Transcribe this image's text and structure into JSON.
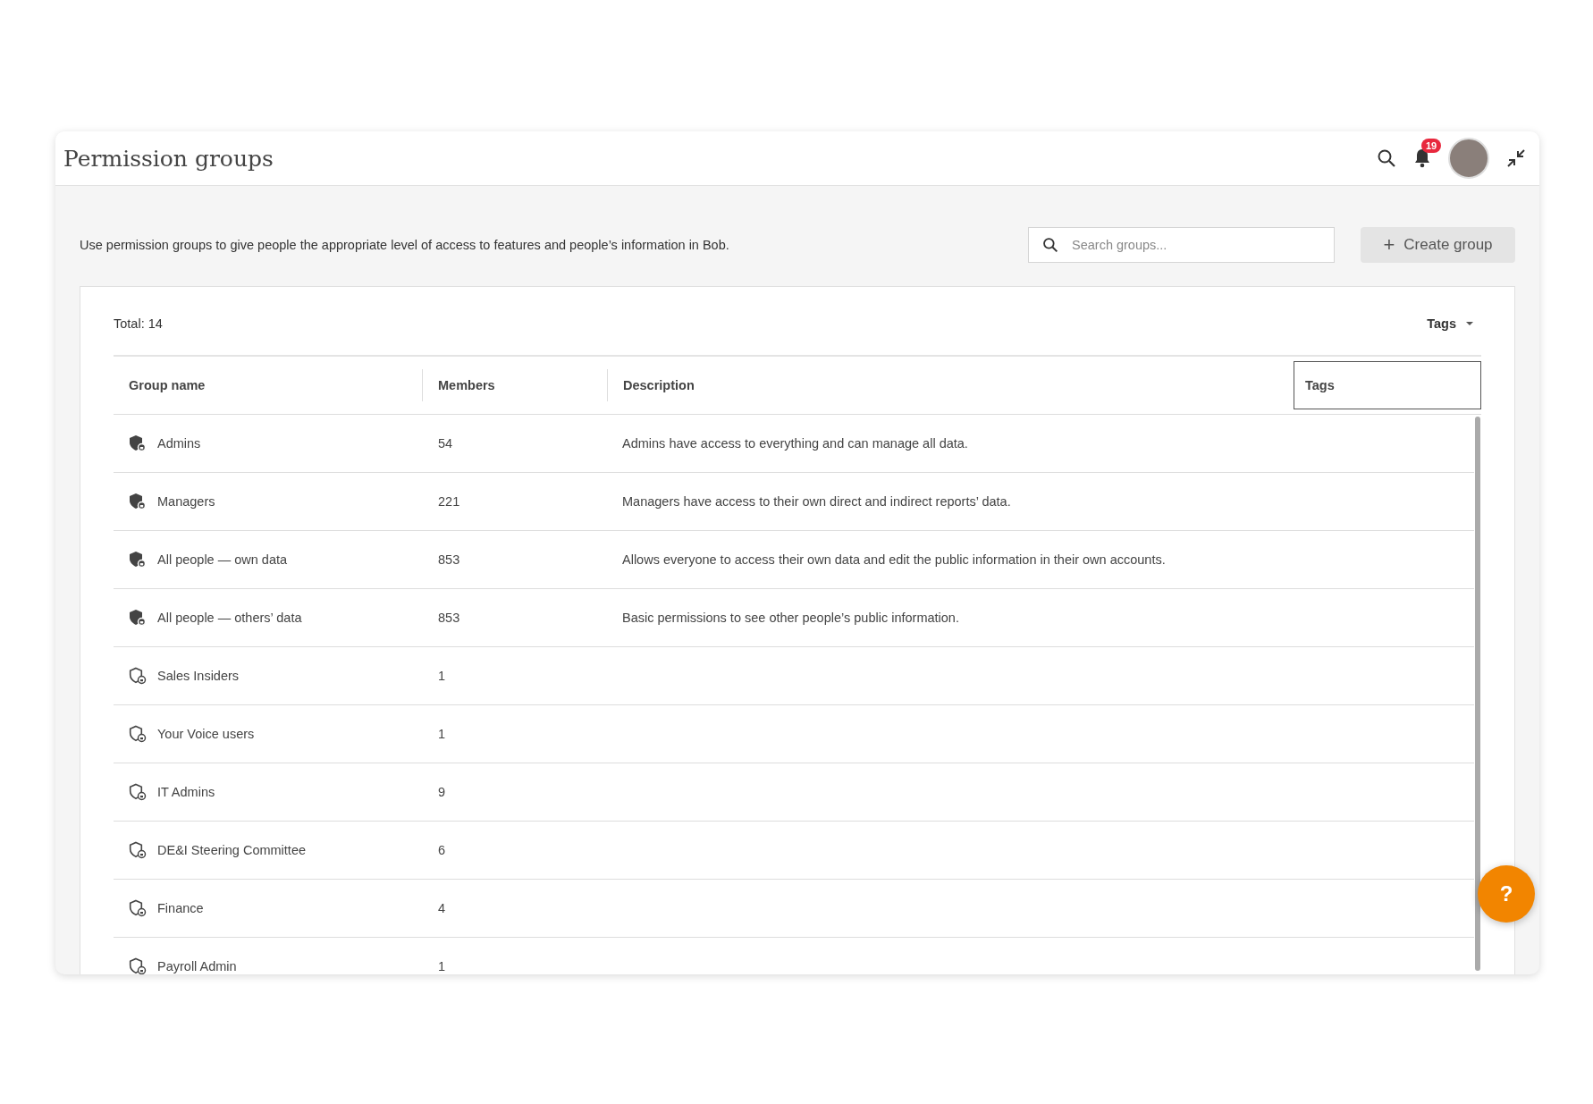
{
  "header": {
    "title": "Permission groups",
    "notification_count": "19"
  },
  "intro": {
    "text": "Use permission groups to give people the appropriate level of access to features and people’s information in Bob.",
    "search": {
      "placeholder": "Search groups..."
    },
    "create_button": {
      "icon": "+",
      "label": "Create group"
    }
  },
  "table": {
    "total": "Total: 14",
    "tags_filter": "Tags",
    "columns": [
      "Group name",
      "Members",
      "Description",
      "Tags"
    ],
    "rows": [
      {
        "kind": "default",
        "name": "Admins",
        "members": "54",
        "description": "Admins have access to everything and can manage all data."
      },
      {
        "kind": "default",
        "name": "Managers",
        "members": "221",
        "description": "Managers have access to their own direct and indirect reports’ data."
      },
      {
        "kind": "default",
        "name": "All people — own data",
        "members": "853",
        "description": "Allows everyone to access their own data and edit the public information in their own accounts."
      },
      {
        "kind": "default",
        "name": "All people — others’ data",
        "members": "853",
        "description": "Basic permissions to see other people’s public information."
      },
      {
        "kind": "custom",
        "name": "Sales Insiders",
        "members": "1"
      },
      {
        "kind": "custom",
        "name": "Your Voice users",
        "members": "1"
      },
      {
        "kind": "custom",
        "name": "IT Admins",
        "members": "9"
      },
      {
        "kind": "custom",
        "name": "DE&I Steering Committee",
        "members": "6"
      },
      {
        "kind": "custom",
        "name": "Finance",
        "members": "4"
      },
      {
        "kind": "custom",
        "name": "Payroll Admin",
        "members": "1"
      }
    ]
  },
  "help_button": {
    "label": "?"
  }
}
